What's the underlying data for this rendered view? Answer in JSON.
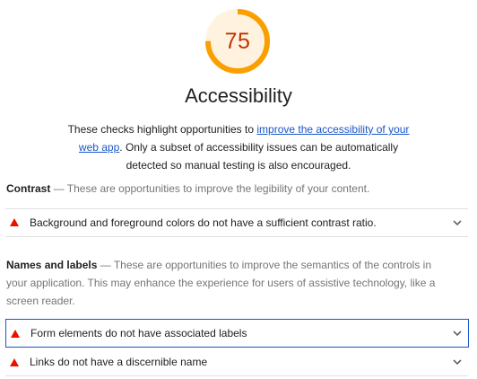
{
  "score": {
    "value": "75",
    "fraction": 0.75,
    "color": "#fa9f00"
  },
  "title": "Accessibility",
  "description": {
    "before": "These checks highlight opportunities to ",
    "link": "improve the accessibility of your web app",
    "after": ". Only a subset of accessibility issues can be automatically detected so manual testing is also encouraged."
  },
  "groups": [
    {
      "name": "Contrast",
      "separator": " — ",
      "desc": "These are opportunities to improve the legibility of your content.",
      "audits": [
        {
          "label": "Background and foreground colors do not have a sufficient contrast ratio.",
          "status": "fail"
        }
      ]
    },
    {
      "name": "Names and labels",
      "separator": " — ",
      "desc": "These are opportunities to improve the semantics of the controls in your application. This may enhance the experience for users of assistive technology, like a screen reader.",
      "audits": [
        {
          "label": "Form elements do not have associated labels",
          "status": "fail",
          "focused": true
        },
        {
          "label": "Links do not have a discernible name",
          "status": "fail"
        }
      ]
    }
  ],
  "colors": {
    "fail": "#eb0f00",
    "link": "#1a56c8",
    "focus": "#1a56c8"
  },
  "icons": {
    "fail": "warning-triangle-icon",
    "expand": "chevron-down-icon"
  }
}
